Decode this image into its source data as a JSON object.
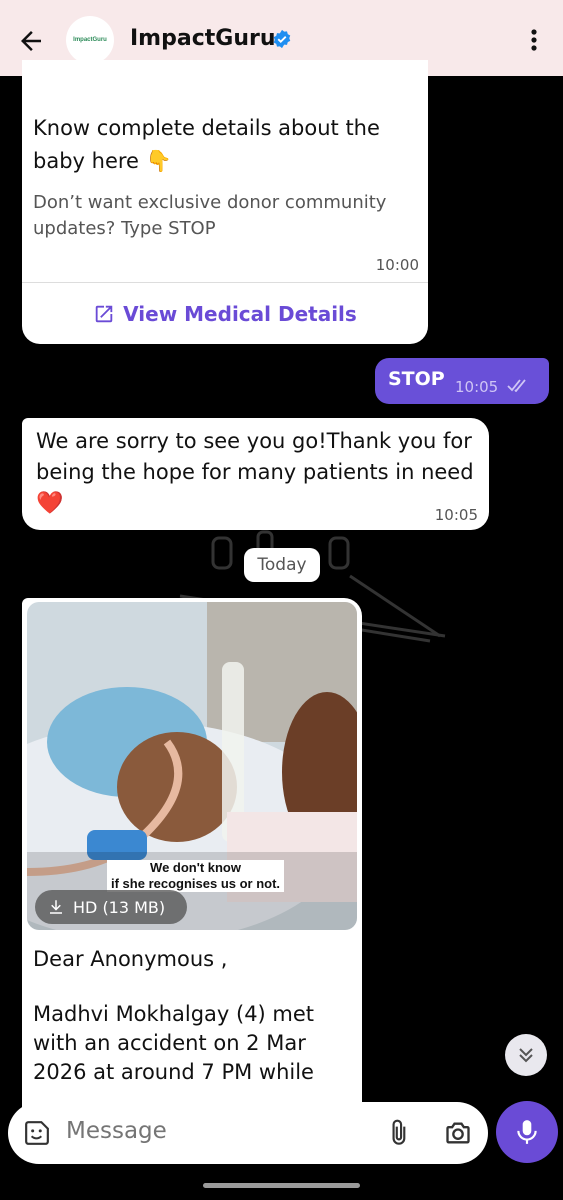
{
  "header": {
    "title": "ImpactGuru",
    "avatar_text": "ImpactGuru"
  },
  "messages": {
    "card": {
      "text": "Know complete details about the baby here 👇",
      "subtext": "Don’t want exclusive donor community updates? Type STOP",
      "time": "10:00",
      "action_label": "View Medical Details"
    },
    "outgoing": {
      "text": "STOP",
      "time": "10:05"
    },
    "reply": {
      "text": "We are sorry to see you go!Thank you for being the hope for many patients in need",
      "heart": "❤️",
      "time": "10:05"
    },
    "date_chip": "Today",
    "media": {
      "caption": "We don't know\nif she recognises us or not.",
      "download_label": "HD (13 MB)",
      "greeting": "Dear Anonymous ,",
      "body": "Madhvi Mokhalgay (4) met with an accident on 2 Mar 2026 at around 7 PM while"
    }
  },
  "composer": {
    "placeholder": "Message"
  },
  "colors": {
    "accent": "#6a4bd6",
    "outgoing_bubble": "#6950d8",
    "header_bg": "#f8e9ea"
  }
}
